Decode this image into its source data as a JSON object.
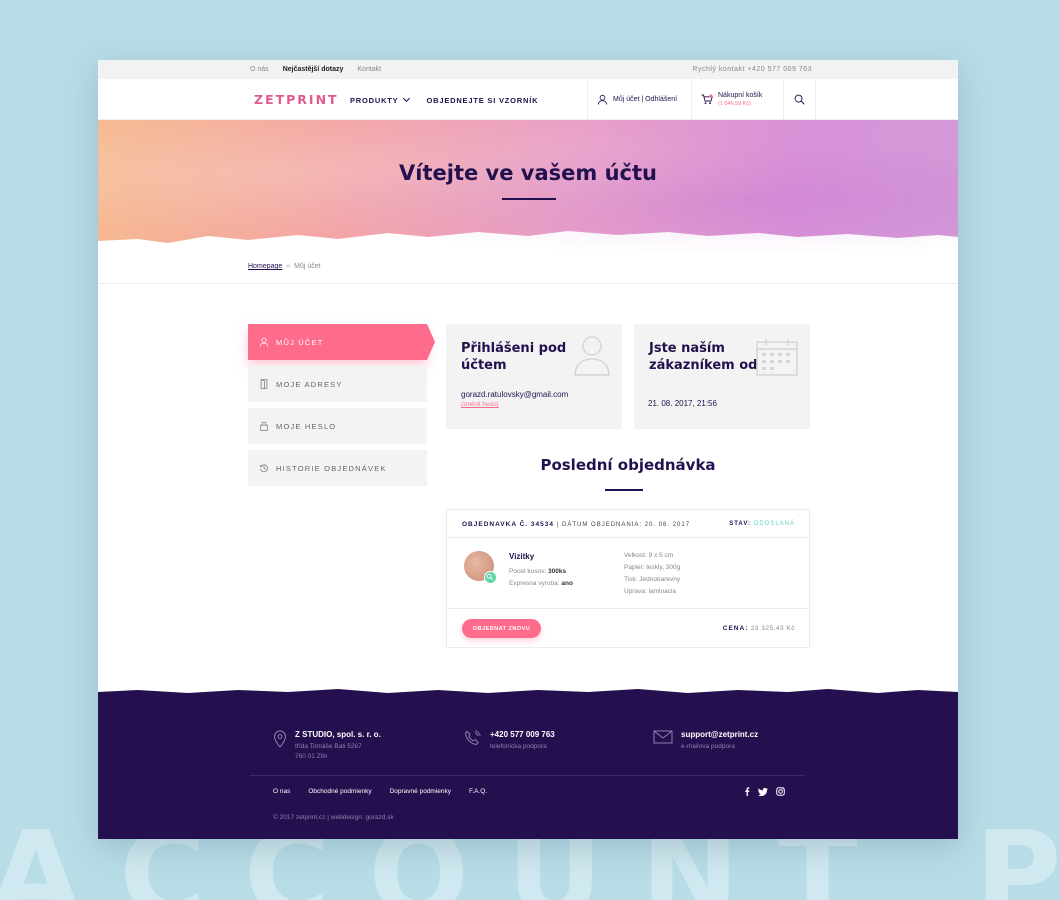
{
  "background_word": "ACCOUNT PAGE",
  "topbar": {
    "links": [
      "O nás",
      "Nejčastější dotazy",
      "Kontakt"
    ],
    "active_link": "Nejčastější dotazy",
    "contact": "Rychlý kontakt +420 577 009 763"
  },
  "header": {
    "logo": "ZETPRINT",
    "nav": [
      "PRODUKTY",
      "OBJEDNEJTE SI VZORNÍK"
    ],
    "account": "Můj účet | Odhlášení",
    "cart_label": "Nákupní košík",
    "cart_total": "(1 046,59 Kč)"
  },
  "hero": {
    "title": "Vítejte ve vašem účtu"
  },
  "breadcrumb": {
    "home": "Homepage",
    "sep": "»",
    "current": "Můj účet"
  },
  "sidebar": {
    "items": [
      {
        "label": "MŮJ ÚČET",
        "icon": "user-icon",
        "active": true
      },
      {
        "label": "MOJE ADRESY",
        "icon": "door-icon",
        "active": false
      },
      {
        "label": "MOJE HESLO",
        "icon": "lock-icon",
        "active": false
      },
      {
        "label": "HISTORIE OBJEDNÁVEK",
        "icon": "history-icon",
        "active": false
      }
    ]
  },
  "cards": {
    "login": {
      "title": "Přihlášeni pod účtem",
      "email": "gorazd.ratulovsky@gmail.com",
      "change_password": "(změnit heslo)"
    },
    "customer": {
      "title": "Jste naším zákazníkem od",
      "date": "21. 08. 2017, 21:56"
    }
  },
  "last_order": {
    "title": "Poslední objednávka",
    "number": "OBJEDNAVKA Č. 34534",
    "date": "| DÁTUM OBJEDNANIA: 20. 08. 2017",
    "status_label": "STAV:",
    "status_value": "ODOSLANÁ",
    "product": {
      "name": "Vizitky",
      "qty_label": "Pocet kusov:",
      "qty_value": "300ks",
      "express_label": "Expresna vyroba:",
      "express_value": "ano"
    },
    "specs": [
      "Velkost: 9 x 5 cm",
      "Papier: leskly, 300g",
      "Tisk: Jednobarevny",
      "Uprava: laminacia"
    ],
    "reorder_button": "OBJEDNAT ZNOVU",
    "price_label": "CENA:",
    "price_value": "23 325,43 Kč"
  },
  "footer": {
    "company": {
      "name": "Z STUDIO, spol. s. r. o.",
      "street": "třída Tomáše Bati 5267",
      "city": "760 01 Zlín"
    },
    "phone": {
      "number": "+420 577 009 763",
      "label": "telefonicka podpora"
    },
    "email": {
      "address": "support@zetprint.cz",
      "label": "e-mailova podpora"
    },
    "links": [
      "O nas",
      "Obchodné podmienky",
      "Dopravné podmienky",
      "F.A.Q."
    ],
    "copyright": "©  2017 zetprint.cz  |  webdesign: gorazd.sk"
  },
  "colors": {
    "accent": "#ff6b8b",
    "navy": "#22114e",
    "footer_bg": "#24104f",
    "status": "#5ed6c0",
    "page_bg": "#b9dde7"
  }
}
